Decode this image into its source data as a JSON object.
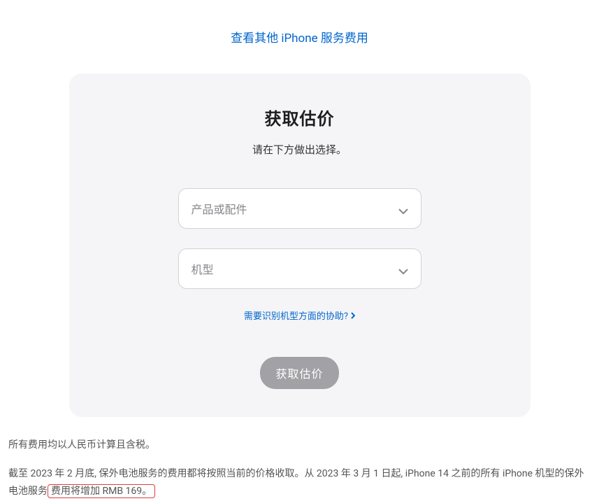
{
  "top_link": "查看其他 iPhone 服务费用",
  "card": {
    "title": "获取估价",
    "subtitle": "请在下方做出选择。",
    "select_product": "产品或配件",
    "select_model": "机型",
    "help_link": "需要识别机型方面的协助?",
    "button": "获取估价"
  },
  "footer": {
    "line1": "所有费用均以人民币计算且含税。",
    "line2_part1": "截至 2023 年 2 月底, 保外电池服务的费用都将按照当前的价格收取。从 2023 年 3 月 1 日起, iPhone 14 之前的所有 iPhone 机型的保外电池服务",
    "line2_highlight": "费用将增加 RMB 169。"
  }
}
